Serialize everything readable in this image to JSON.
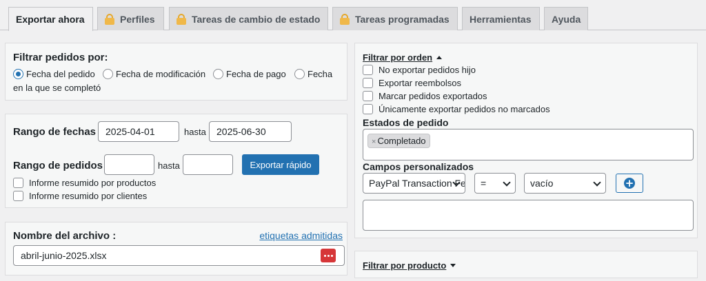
{
  "tabs": [
    {
      "label": "Exportar ahora",
      "active": true,
      "locked": false
    },
    {
      "label": "Perfiles",
      "active": false,
      "locked": true
    },
    {
      "label": "Tareas de cambio de estado",
      "active": false,
      "locked": true
    },
    {
      "label": "Tareas programadas",
      "active": false,
      "locked": true
    },
    {
      "label": "Herramientas",
      "active": false,
      "locked": false
    },
    {
      "label": "Ayuda",
      "active": false,
      "locked": false
    }
  ],
  "filter_orders": {
    "title": "Filtrar pedidos por:",
    "options": [
      "Fecha del pedido",
      "Fecha de modificación",
      "Fecha de pago",
      "Fecha"
    ],
    "option_continuation": "en la que se completó",
    "selected": "Fecha del pedido"
  },
  "date_range": {
    "label": "Rango de fechas",
    "from": "2025-04-01",
    "separator": "hasta",
    "to": "2025-06-30"
  },
  "order_range": {
    "label": "Rango de pedidos",
    "from": "",
    "separator": "hasta",
    "to": "",
    "quick_export_label": "Exportar rápido"
  },
  "summary_checkboxes": [
    {
      "label": "Informe resumido por productos",
      "checked": false
    },
    {
      "label": "Informe resumido por clientes",
      "checked": false
    }
  ],
  "filename": {
    "label": "Nombre del archivo :",
    "tags_link": "etiquetas admitidas",
    "value": "abril-junio-2025.xlsx",
    "icon": "password-dots-icon"
  },
  "filter_by_order": {
    "title": "Filtrar por orden",
    "expanded": true,
    "checkboxes": [
      {
        "label": "No exportar pedidos hijo",
        "checked": false
      },
      {
        "label": "Exportar reembolsos",
        "checked": false
      },
      {
        "label": "Marcar pedidos exportados",
        "checked": false
      },
      {
        "label": "Únicamente exportar pedidos no marcados",
        "checked": false
      }
    ],
    "order_status_title": "Estados de pedido",
    "order_status_tags": [
      "Completado"
    ],
    "custom_fields_title": "Campos personalizados",
    "custom_field": "PayPal Transaction Fee",
    "operator": "=",
    "value": "vacío"
  },
  "filter_by_product": {
    "title": "Filtrar por producto",
    "expanded": false
  },
  "colors": {
    "accent": "#2271b1",
    "lock": "#f0b849",
    "danger": "#d63638"
  }
}
